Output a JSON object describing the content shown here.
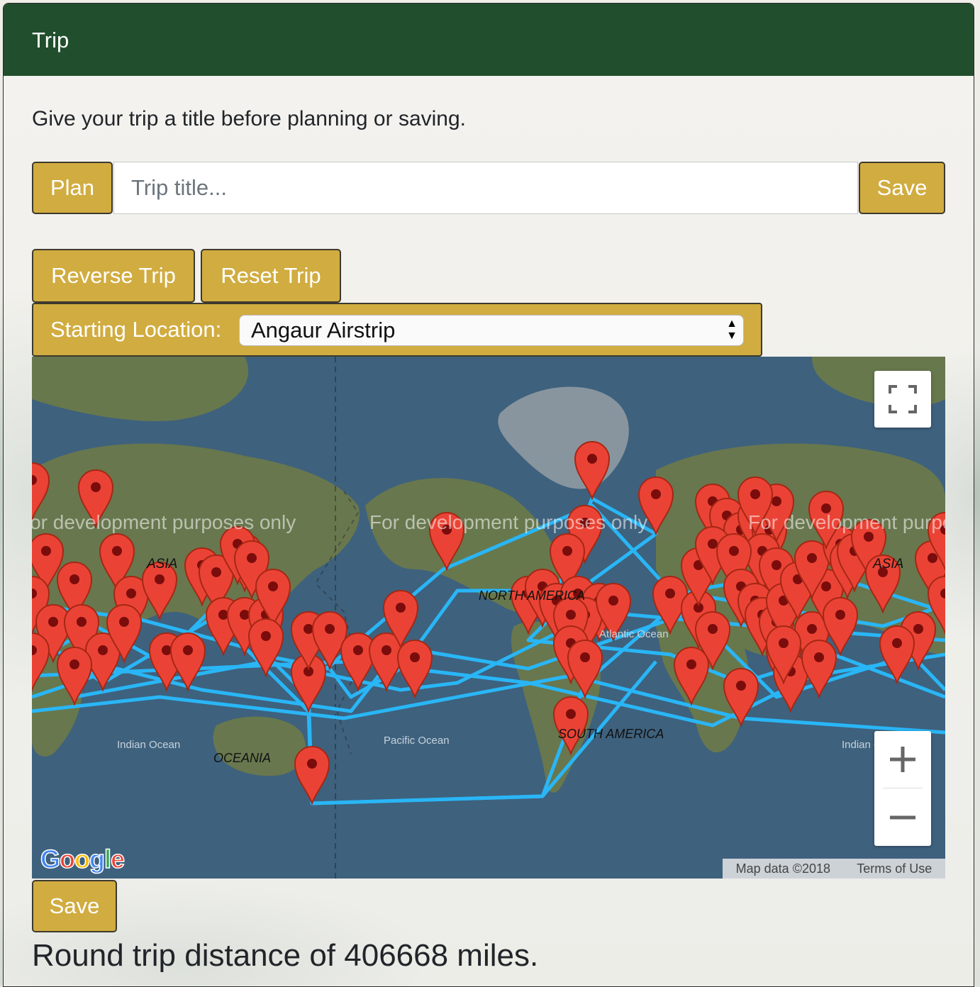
{
  "header": {
    "title": "Trip"
  },
  "intro": "Give your trip a title before planning or saving.",
  "plan_button": "Plan",
  "title_input": {
    "placeholder": "Trip title...",
    "value": ""
  },
  "save_button": "Save",
  "reverse_button": "Reverse Trip",
  "reset_button": "Reset Trip",
  "starting_location": {
    "label": "Starting Location:",
    "selected": "Angaur Airstrip"
  },
  "map": {
    "watermark": "For development purposes only",
    "continent_labels": {
      "asia": "ASIA",
      "asia_right": "ASIA",
      "north_america": "NORTH AMERICA",
      "south_america": "SOUTH AMERICA",
      "oceania": "OCEANIA",
      "indian_ocean": "Indian Ocean",
      "indian_ocean_right": "Indian Ocean",
      "pacific_ocean": "Pacific Ocean",
      "atlantic_ocean": "Atlantic Ocean"
    },
    "fullscreen_icon": "fullscreen-icon",
    "zoom_in_icon": "plus-icon",
    "zoom_out_icon": "minus-icon",
    "logo": "Google",
    "map_data": "Map data ©2018",
    "terms": "Terms of Use",
    "route_color": "#29b6f6",
    "marker_color": "#ea4335"
  },
  "bottom_save_button": "Save",
  "distance_text": "Round trip distance of 406668 miles.",
  "colors": {
    "header": "#214e2c",
    "button": "#d1ac40",
    "ocean": "#3e617d",
    "land": "#6b7a4a"
  }
}
